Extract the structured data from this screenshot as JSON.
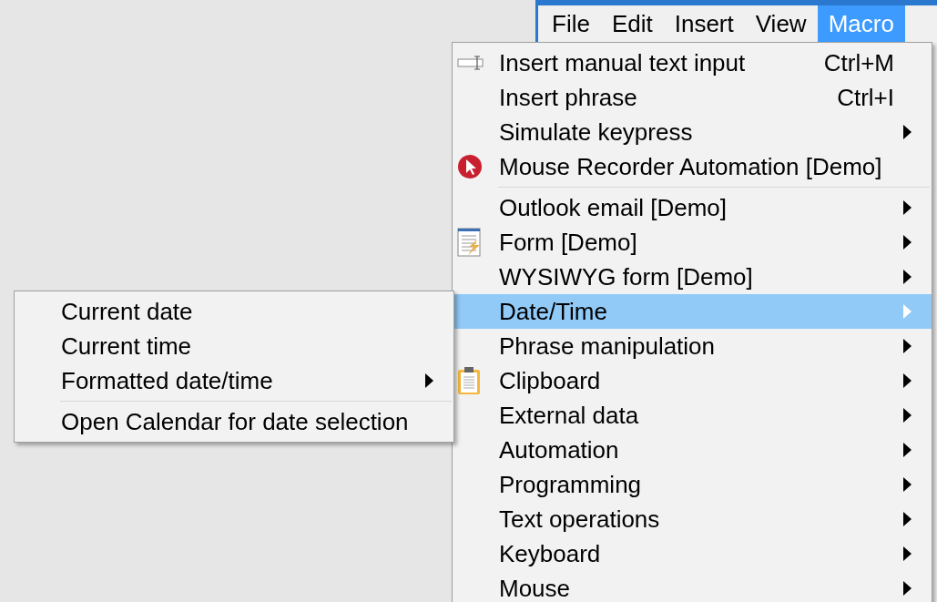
{
  "menubar": [
    {
      "label": "File",
      "selected": false
    },
    {
      "label": "Edit",
      "selected": false
    },
    {
      "label": "Insert",
      "selected": false
    },
    {
      "label": "View",
      "selected": false
    },
    {
      "label": "Macro",
      "selected": true
    }
  ],
  "menu": [
    {
      "kind": "text-input",
      "label": "Insert manual text input",
      "shortcut": "Ctrl+M",
      "submenu": false,
      "selected": false
    },
    {
      "kind": "plain",
      "label": "Insert phrase",
      "shortcut": "Ctrl+I",
      "submenu": false,
      "selected": false
    },
    {
      "kind": "plain",
      "label": "Simulate keypress",
      "submenu": true,
      "selected": false
    },
    {
      "kind": "pointer",
      "label": "Mouse Recorder Automation [Demo]",
      "submenu": false,
      "selected": false
    },
    {
      "kind": "separator"
    },
    {
      "kind": "plain",
      "label": "Outlook email [Demo]",
      "submenu": true,
      "selected": false
    },
    {
      "kind": "form",
      "label": "Form [Demo]",
      "submenu": true,
      "selected": false
    },
    {
      "kind": "plain",
      "label": "WYSIWYG form [Demo]",
      "submenu": true,
      "selected": false
    },
    {
      "kind": "plain",
      "label": "Date/Time",
      "submenu": true,
      "selected": true
    },
    {
      "kind": "plain",
      "label": "Phrase manipulation",
      "submenu": true,
      "selected": false
    },
    {
      "kind": "clipboard",
      "label": "Clipboard",
      "submenu": true,
      "selected": false
    },
    {
      "kind": "plain",
      "label": "External data",
      "submenu": true,
      "selected": false
    },
    {
      "kind": "plain",
      "label": "Automation",
      "submenu": true,
      "selected": false
    },
    {
      "kind": "plain",
      "label": "Programming",
      "submenu": true,
      "selected": false
    },
    {
      "kind": "plain",
      "label": "Text operations",
      "submenu": true,
      "selected": false
    },
    {
      "kind": "plain",
      "label": "Keyboard",
      "submenu": true,
      "selected": false
    },
    {
      "kind": "plain",
      "label": "Mouse",
      "submenu": true,
      "selected": false
    }
  ],
  "submenu": [
    {
      "kind": "plain",
      "label": "Current date",
      "submenu": false,
      "selected": false
    },
    {
      "kind": "plain",
      "label": "Current time",
      "submenu": false,
      "selected": false
    },
    {
      "kind": "plain",
      "label": "Formatted date/time",
      "submenu": true,
      "selected": false
    },
    {
      "kind": "separator"
    },
    {
      "kind": "plain",
      "label": "Open Calendar for date selection",
      "submenu": false,
      "selected": false
    }
  ]
}
